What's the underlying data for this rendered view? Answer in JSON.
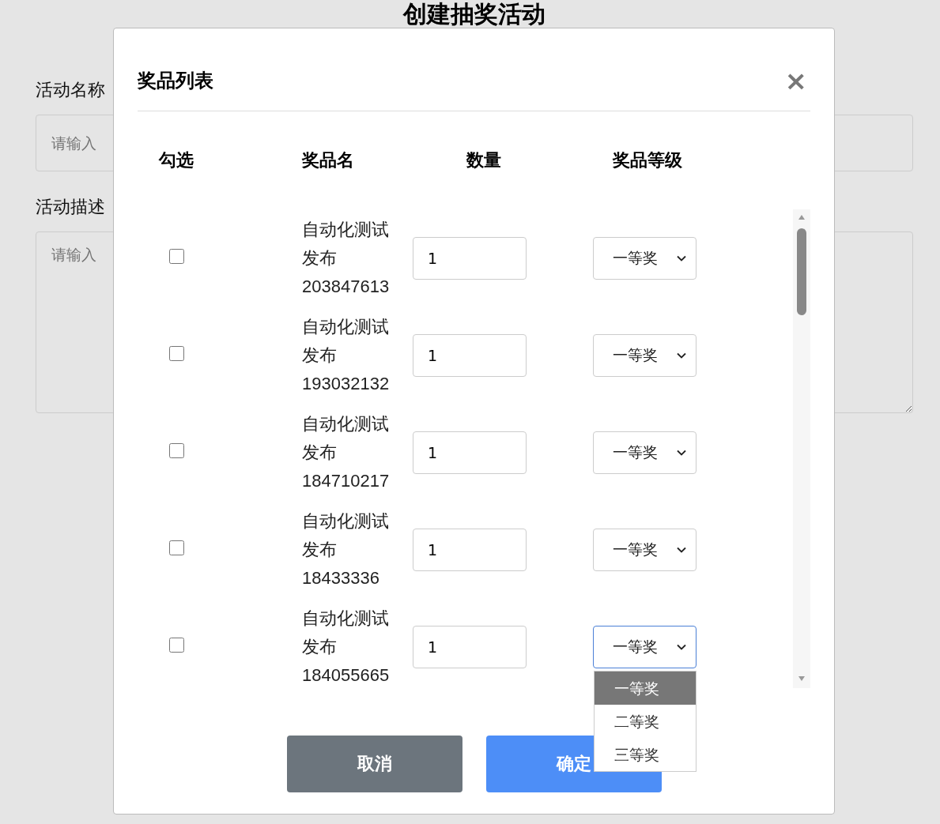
{
  "page": {
    "title": "创建抽奖活动",
    "fields": [
      {
        "label": "活动名称",
        "placeholder": "请输入",
        "kind": "input"
      },
      {
        "label": "活动描述",
        "placeholder": "请输入",
        "kind": "textarea"
      }
    ]
  },
  "modal": {
    "title": "奖品列表",
    "close": "×",
    "columns": [
      "勾选",
      "奖品名",
      "数量",
      "奖品等级"
    ],
    "rows": [
      {
        "checked": false,
        "name": "自动化测试发布203847613",
        "quantity": "1",
        "grade": "一等奖",
        "expanded": false
      },
      {
        "checked": false,
        "name": "自动化测试发布193032132",
        "quantity": "1",
        "grade": "一等奖",
        "expanded": false
      },
      {
        "checked": false,
        "name": "自动化测试发布184710217",
        "quantity": "1",
        "grade": "一等奖",
        "expanded": false
      },
      {
        "checked": false,
        "name": "自动化测试发布18433336",
        "quantity": "1",
        "grade": "一等奖",
        "expanded": false
      },
      {
        "checked": false,
        "name": "自动化测试发布184055665",
        "quantity": "1",
        "grade": "一等奖",
        "expanded": true,
        "options": [
          {
            "label": "一等奖",
            "selected": true
          },
          {
            "label": "二等奖",
            "selected": false
          },
          {
            "label": "三等奖",
            "selected": false
          }
        ]
      }
    ],
    "buttons": [
      {
        "label": "取消",
        "kind": "secondary"
      },
      {
        "label": "确定",
        "kind": "primary"
      }
    ]
  }
}
